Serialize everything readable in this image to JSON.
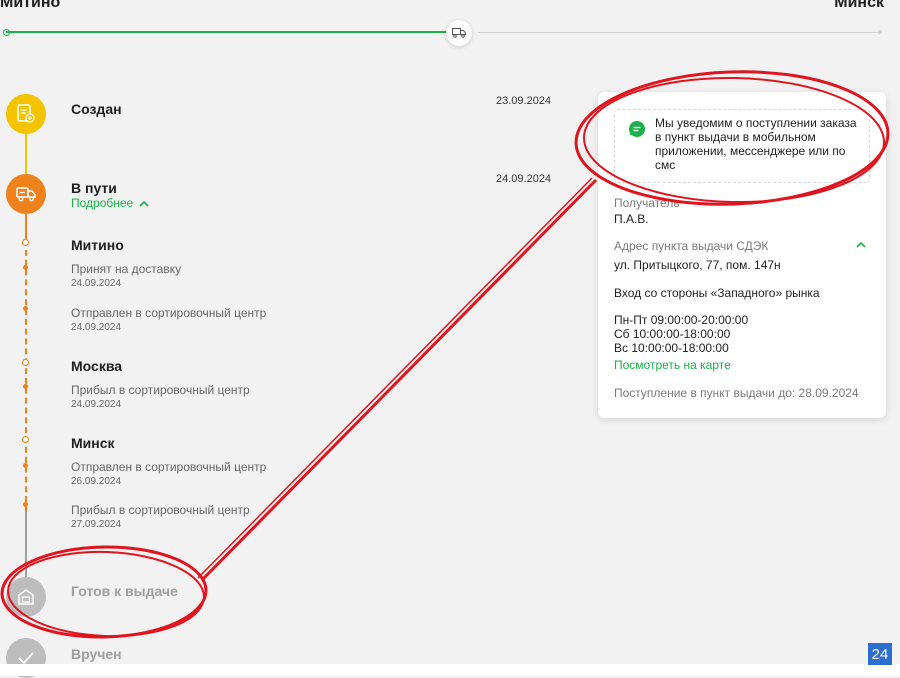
{
  "route": {
    "from": "Митино",
    "to": "Минск",
    "truck_icon": "truck-icon"
  },
  "steps": [
    {
      "title": "Создан",
      "date": "23.09.2024",
      "icon": "document-plus-icon",
      "color": "#f5c400"
    },
    {
      "title": "В пути",
      "date": "24.09.2024",
      "more": "Подробнее",
      "icon": "truck-icon",
      "color": "#f0821e"
    },
    {
      "title": "Готов к выдаче",
      "icon": "pickup-box-icon",
      "color": "#bdbdbd"
    },
    {
      "title": "Вручен",
      "icon": "check-icon",
      "color": "#bdbdbd"
    }
  ],
  "stops": [
    {
      "city": "Митино",
      "events": [
        {
          "text": "Принят на доставку",
          "date": "24.09.2024"
        },
        {
          "text": "Отправлен в сортировочный центр",
          "date": "24.09.2024"
        }
      ]
    },
    {
      "city": "Москва",
      "events": [
        {
          "text": "Прибыл в сортировочный центр",
          "date": "24.09.2024"
        }
      ]
    },
    {
      "city": "Минск",
      "events": [
        {
          "text": "Отправлен в сортировочный центр",
          "date": "26.09.2024"
        },
        {
          "text": "Прибыл в сортировочный центр",
          "date": "27.09.2024"
        }
      ]
    }
  ],
  "card": {
    "notice": "Мы уведомим о поступлении заказа в пункт выдачи в мобильном приложении, мессенджере или по смс",
    "recipient_label": "Получатель",
    "recipient": "П.А.В.",
    "address_label": "Адрес пункта выдачи СДЭК",
    "address": "ул. Притыцкого, 77, пом. 147н",
    "entrance": "Вход со стороны «Западного» рынка",
    "hours": [
      "Пн-Пт 09:00:00-20:00:00",
      "Сб 10:00:00-18:00:00",
      "Вс 10:00:00-18:00:00"
    ],
    "map_link": "Посмотреть на карте",
    "arrival": "Поступление в пункт выдачи до: 28.09.2024"
  },
  "corner_badge": "24",
  "colors": {
    "accent": "#1ab248",
    "orange": "#f0821e",
    "yellow": "#f5c400",
    "annotation": "#e0141e"
  }
}
